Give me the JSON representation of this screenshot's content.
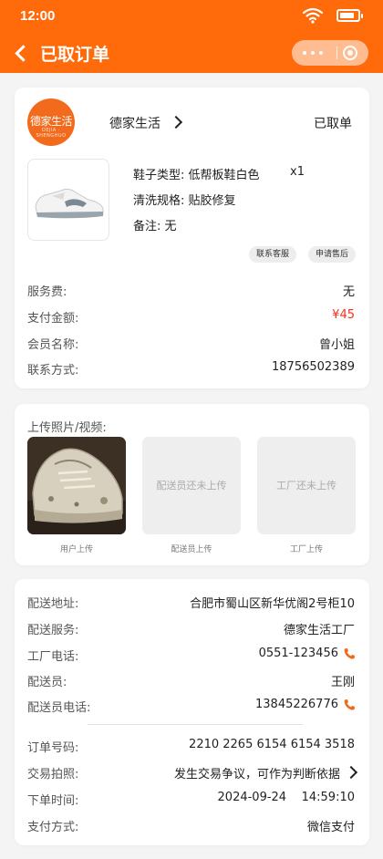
{
  "status_bar": {
    "time": "12:00"
  },
  "header": {
    "title": "已取订单"
  },
  "shop": {
    "name": "德家生活",
    "order_status": "已取单",
    "logo_text": "德家生活",
    "logo_subtext": "DEJIA · SHENGHUO"
  },
  "item": {
    "type_label": "鞋子类型:",
    "type_value": "低帮板鞋白色",
    "qty": "x1",
    "wash_label": "清洗规格:",
    "wash_value": "贴胶修复",
    "note_label": "备注:",
    "note_value": "无"
  },
  "actions": {
    "contact_service": "联系客服",
    "after_sale": "申请售后"
  },
  "fees": [
    {
      "label": "服务费:",
      "value": "无"
    },
    {
      "label": "支付金额:",
      "value": "¥45"
    },
    {
      "label": "会员名称:",
      "value": "曾小姐"
    },
    {
      "label": "联系方式:",
      "value": "18756502389"
    }
  ],
  "upload": {
    "title": "上传照片/视频:",
    "user_caption": "用户上传",
    "courier_placeholder": "配送员还未上传",
    "courier_caption": "配送员上传",
    "factory_placeholder": "工厂还未上传",
    "factory_caption": "工厂上传"
  },
  "delivery": [
    {
      "label": "配送地址:",
      "value": "合肥市蜀山区新华优阁2号柜10"
    },
    {
      "label": "配送服务:",
      "value": "德家生活工厂"
    },
    {
      "label": "工厂电话:",
      "value": "0551-123456"
    },
    {
      "label": "配送员:",
      "value": "王刚"
    },
    {
      "label": "配送员电话:",
      "value": "13845226776"
    }
  ],
  "order": [
    {
      "label": "订单号码:",
      "value": "2210 2265 6154 6154 3518"
    },
    {
      "label": "交易拍照:",
      "value": "发生交易争议，可作为判断依据"
    },
    {
      "label": "下单时间:",
      "value": "2024-09-24    14:59:10"
    },
    {
      "label": "支付方式:",
      "value": "微信支付"
    }
  ],
  "colors": {
    "brand": "#ff6a0b",
    "price": "#ff2a1a",
    "phone_icon": "#f26a1b"
  }
}
